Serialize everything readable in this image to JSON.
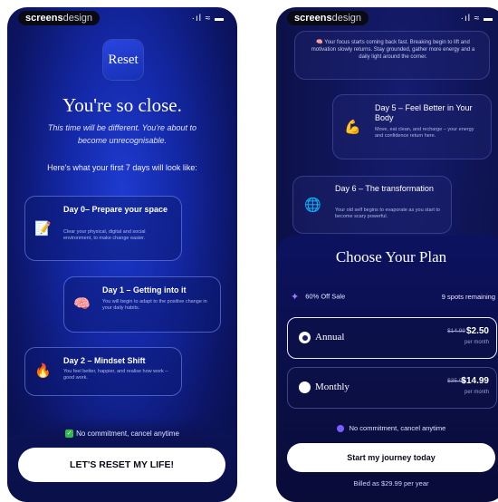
{
  "screen1": {
    "brand_bold": "screens",
    "brand_light": "design",
    "status_icons": "·ıl ≈ ▬",
    "logo_text": "Reset",
    "title": "You're so close.",
    "subtitle": "This time will be different. You're about to become unrecognisable.",
    "intro": "Here's what your first 7 days will look like:",
    "days": [
      {
        "icon": "📝",
        "title": "Day 0– Prepare your space",
        "body": "Clear your physical, digital and social environment, to make change easier."
      },
      {
        "icon": "🧠",
        "title": "Day 1 – Getting into it",
        "body": "You will begin to adapt to the positive change in your daily habits."
      },
      {
        "icon": "🔥",
        "title": "Day 2 – Mindset Shift",
        "body": "You feel better, happier, and realise how work – good work."
      }
    ],
    "commitment": "No commitment, cancel anytime",
    "cta": "LET'S RESET MY LIFE!"
  },
  "screen2": {
    "brand_bold": "screens",
    "brand_light": "design",
    "status_icons": "·ıl ≈ ▬",
    "focus_text": "🧠 Your focus starts coming back fast. Breaking begin to lift and motivation slowly returns. Stay grounded, gather more energy and a daily light around the corner.",
    "days": [
      {
        "icon": "💪",
        "title": "Day 5 – Feel Better in Your Body",
        "body": "Move, eat clean, and recharge – your energy and confidence return here."
      },
      {
        "icon": "🌐",
        "title": "Day 6 – The transformation",
        "body": "Your old self begins to evaporate as you start to become scary powerful."
      }
    ],
    "plan_title": "Choose Your Plan",
    "offer": "60% Off Sale",
    "spots": "9 spots remaining",
    "plans": [
      {
        "name": "Annual",
        "old_price": "$14.99",
        "price": "$2.50",
        "period": "per month",
        "selected": true
      },
      {
        "name": "Monthly",
        "old_price": "$35.00",
        "price": "$14.99",
        "period": "per month",
        "selected": false
      }
    ],
    "commitment": "No commitment, cancel anytime",
    "cta": "Start my journey today",
    "billed": "Billed as $29.99 per year"
  }
}
